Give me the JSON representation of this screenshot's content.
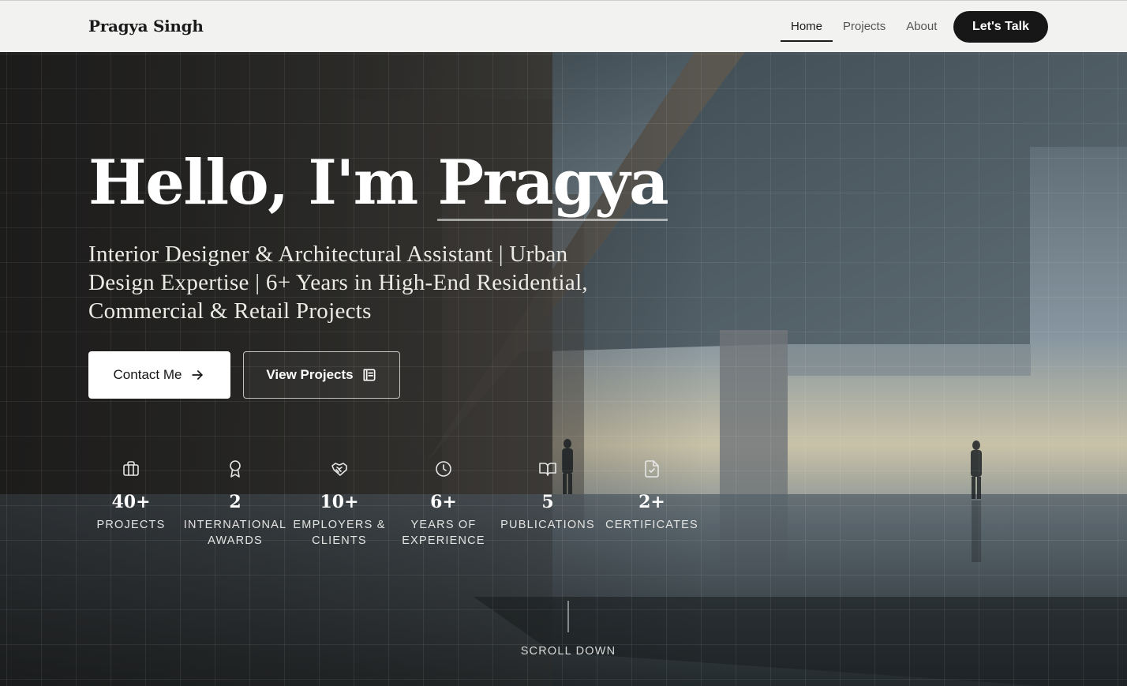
{
  "nav": {
    "brand": "Pragya Singh",
    "links": [
      "Home",
      "Projects",
      "About"
    ],
    "active": "Home",
    "cta": "Let's Talk"
  },
  "hero": {
    "greeting": "Hello, I'm",
    "name": "Pragya",
    "tagline": "Interior Designer & Architectural Assistant | Urban Design Expertise | 6+ Years in High-End Residential, Commercial & Retail Projects",
    "primary_button": "Contact Me",
    "primary_button_icon": "arrow-right-icon",
    "secondary_button": "View Projects",
    "secondary_button_icon": "scroll-icon"
  },
  "stats": [
    {
      "icon": "briefcase-icon",
      "value": "40+",
      "label": "PROJECTS"
    },
    {
      "icon": "award-icon",
      "value": "2",
      "label": "INTERNATIONAL AWARDS"
    },
    {
      "icon": "handshake-icon",
      "value": "10+",
      "label": "EMPLOYERS & CLIENTS"
    },
    {
      "icon": "clock-icon",
      "value": "6+",
      "label": "YEARS OF EXPERIENCE"
    },
    {
      "icon": "book-open-icon",
      "value": "5",
      "label": "PUBLICATIONS"
    },
    {
      "icon": "file-check-icon",
      "value": "2+",
      "label": "CERTIFICATES"
    }
  ],
  "scroll_label": "SCROLL DOWN",
  "colors": {
    "nav_bg": "#f2f2f1",
    "cta_bg": "#171717",
    "text_light": "#ffffff"
  }
}
